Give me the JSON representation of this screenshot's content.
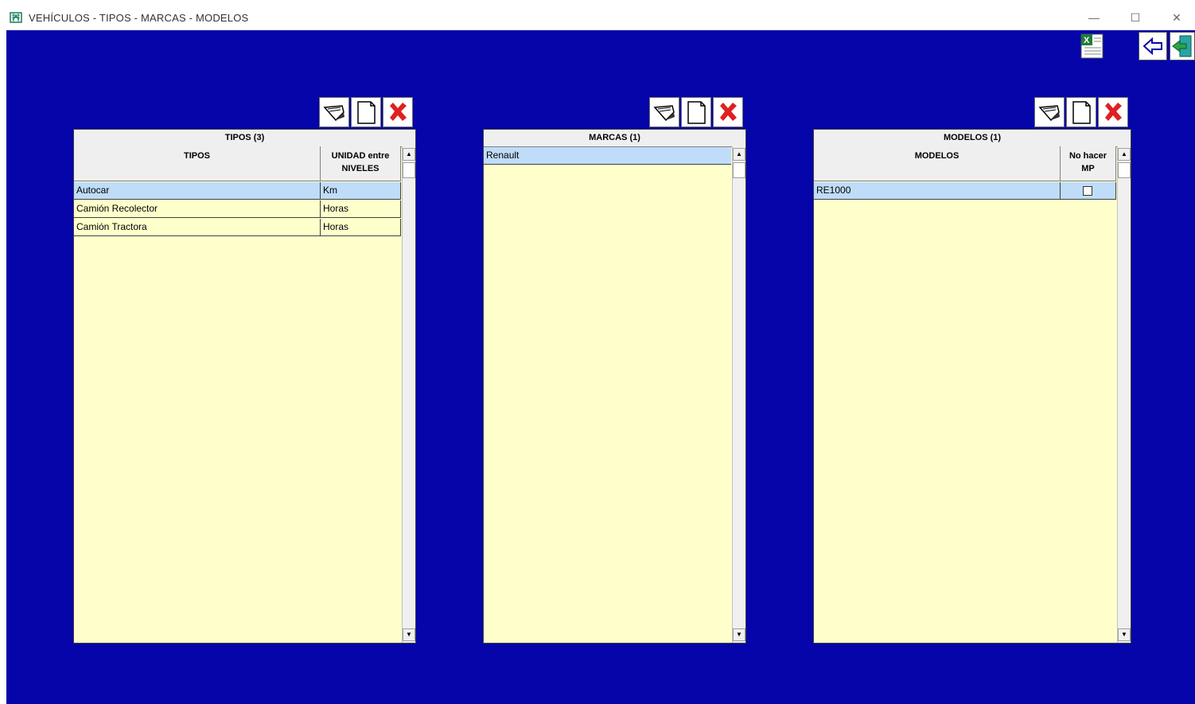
{
  "window": {
    "title": "VEHÍCULOS - TIPOS - MARCAS - MODELOS",
    "minimize": "—",
    "maximize": "☐",
    "close": "✕"
  },
  "colors": {
    "background": "#0505AA",
    "grid": "#FFFFCC",
    "selected_row": "#BFDCF8",
    "header": "#EFEFEF",
    "delete": "#E02020"
  },
  "toolbar": {
    "excel_icon": "excel-export-icon",
    "back_icon": "back-arrow-icon",
    "exit_icon": "exit-door-icon"
  },
  "tipos": {
    "title": "TIPOS (3)",
    "columns": [
      "TIPOS",
      "UNIDAD entre NIVELES"
    ],
    "rows": [
      {
        "name": "Autocar",
        "unit": "Km"
      },
      {
        "name": "Camión Recolector",
        "unit": "Horas"
      },
      {
        "name": "Camión Tractora",
        "unit": "Horas"
      }
    ]
  },
  "marcas": {
    "title": "MARCAS (1)",
    "rows": [
      {
        "name": "Renault"
      }
    ]
  },
  "modelos": {
    "title": "MODELOS (1)",
    "columns": [
      "MODELOS",
      "No hacer MP"
    ],
    "rows": [
      {
        "name": "RE1000",
        "no_mp": false
      }
    ]
  },
  "scroll": {
    "up": "▲",
    "down": "▼"
  }
}
